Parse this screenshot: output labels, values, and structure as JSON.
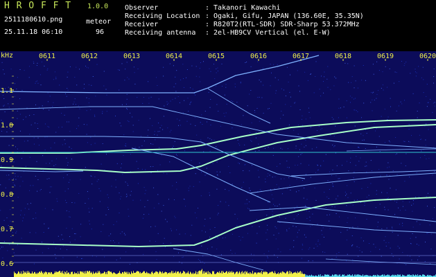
{
  "header": {
    "app_title": "H R O F F T",
    "app_version": "1.0.0",
    "filename": "2511180610.png",
    "mode": "meteor",
    "datetime": "25.11.18 06:10",
    "count": "96",
    "fields": [
      {
        "label": "Observer",
        "value": ": Takanori Kawachi"
      },
      {
        "label": "Receiving Location",
        "value": ": Ogaki, Gifu, JAPAN (136.60E, 35.35N)"
      },
      {
        "label": "Receiver",
        "value": ": R820T2(RTL-SDR) SDR-Sharp 53.372MHz"
      },
      {
        "label": "Receiving antenna",
        "value": ": 2el-HB9CV Vertical (el. E-W)"
      }
    ]
  },
  "chart_data": {
    "type": "heatmap",
    "ylabel": "kHz",
    "x_ticks": [
      "0611",
      "0612",
      "0613",
      "0614",
      "0615",
      "0616",
      "0617",
      "0618",
      "0619",
      "0620"
    ],
    "y_ticks": [
      "1.1",
      "1.0",
      "0.9",
      "0.8",
      "0.7",
      "0.6"
    ],
    "ylim": [
      0.6,
      1.18
    ],
    "colors": {
      "background": "#0c0c5a",
      "trace": "#7fb2ff",
      "strong": "#a8ffc8",
      "labels": "#f0f04a",
      "baseline": "#f0f04a"
    }
  }
}
